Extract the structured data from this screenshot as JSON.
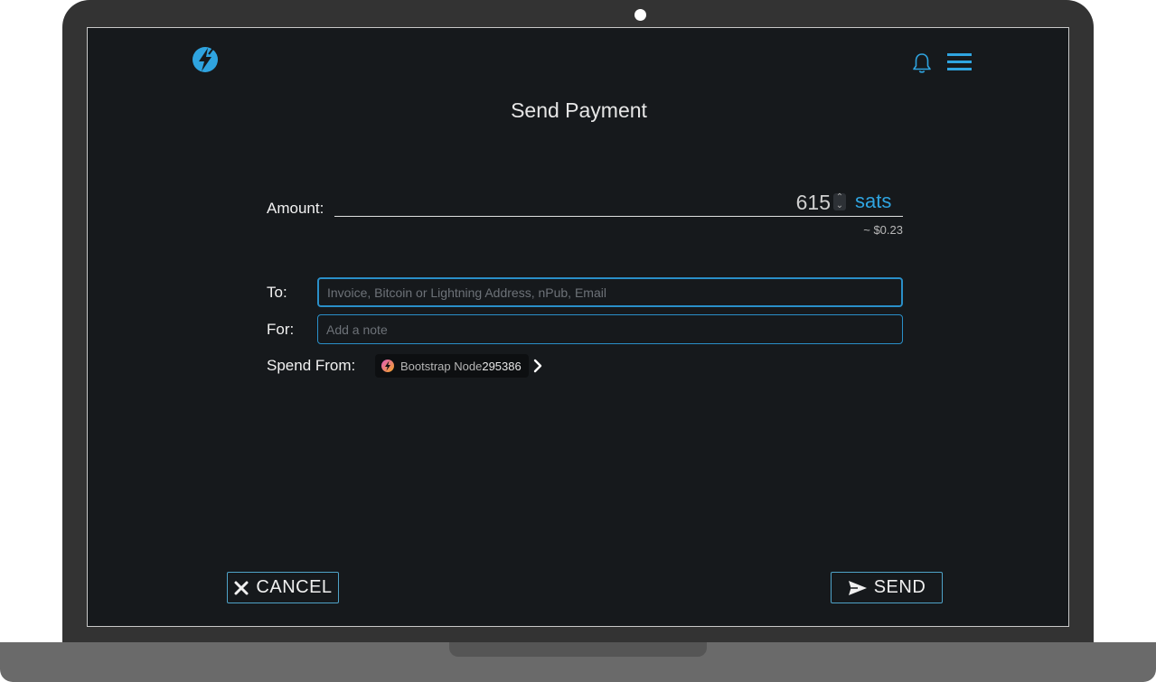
{
  "header": {
    "logo_icon": "lightning-bolt-icon",
    "notification_icon": "bell-icon",
    "menu_icon": "hamburger-menu-icon",
    "accent_color": "#2fa4e0"
  },
  "page": {
    "title": "Send Payment"
  },
  "amount": {
    "label": "Amount:",
    "value": "615",
    "unit": "sats",
    "fiat": "~ $0.23"
  },
  "to": {
    "label": "To:",
    "value": "",
    "placeholder": "Invoice, Bitcoin or Lightning Address, nPub, Email"
  },
  "for": {
    "label": "For:",
    "value": "",
    "placeholder": "Add a note"
  },
  "spend_from": {
    "label": "Spend From:",
    "node_name": "Bootstrap Node",
    "node_number": "295386"
  },
  "actions": {
    "cancel_label": "CANCEL",
    "send_label": "SEND"
  }
}
